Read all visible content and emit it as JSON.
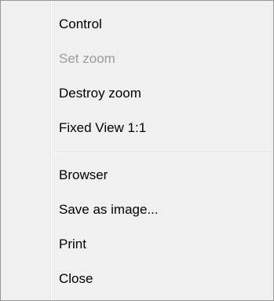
{
  "menu": {
    "items": [
      {
        "label": "Control",
        "enabled": true
      },
      {
        "label": "Set zoom",
        "enabled": false
      },
      {
        "label": "Destroy zoom",
        "enabled": true
      },
      {
        "label": "Fixed View 1:1",
        "enabled": true
      },
      {
        "label": "Browser",
        "enabled": true
      },
      {
        "label": "Save as image...",
        "enabled": true
      },
      {
        "label": "Print",
        "enabled": true
      },
      {
        "label": "Close",
        "enabled": true
      }
    ]
  },
  "colors": {
    "background": "#f0f0f0",
    "border": "#979797",
    "text": "#000000",
    "disabled_text": "#9d9d9d"
  }
}
